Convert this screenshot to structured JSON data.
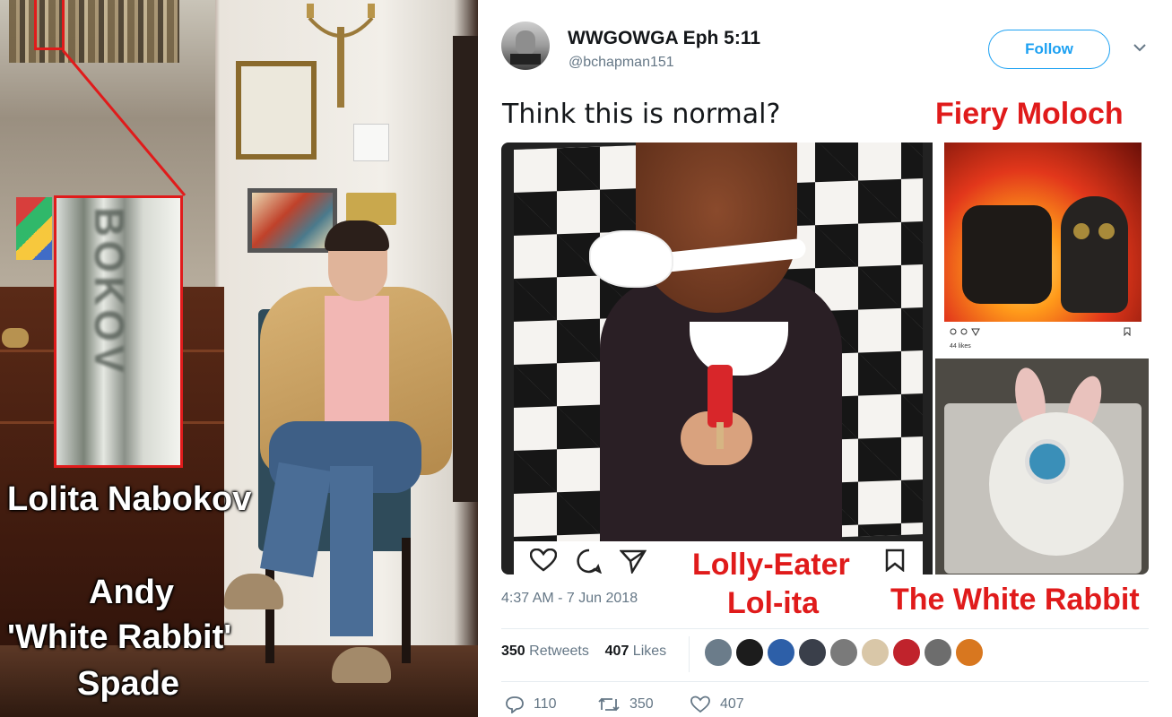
{
  "left_photo": {
    "zoom_text": "BOKOV",
    "caption_book": "Lolita Nabokov",
    "caption_person_line1": "Andy",
    "caption_person_line2": "'White Rabbit'",
    "caption_person_line3": "Spade"
  },
  "tweet": {
    "display_name": "WWGOWGA Eph 5:11",
    "handle": "@bchapman151",
    "follow_label": "Follow",
    "text": "Think this is normal?",
    "timestamp": "4:37 AM - 7 Jun 2018",
    "retweets_count": "350",
    "retweets_label": "Retweets",
    "likes_count": "407",
    "likes_label": "Likes",
    "liker_colors": [
      "#6b7c8a",
      "#1c1c1c",
      "#2d5fa8",
      "#3a3f4a",
      "#7a7a7a",
      "#d9c7a8",
      "#c0232c",
      "#6d6d6d",
      "#d8771f"
    ],
    "reply_count": "110",
    "retweet_count": "350",
    "like_count": "407",
    "ig_likes_small": "44 likes"
  },
  "annotations": {
    "fiery": "Fiery Moloch",
    "lolly_line1": "Lolly-Eater",
    "lolly_line2": "Lol-ita",
    "rabbit": "The White Rabbit"
  },
  "colors": {
    "annotation_red": "#e01b1b",
    "twitter_blue": "#1da1f2"
  }
}
